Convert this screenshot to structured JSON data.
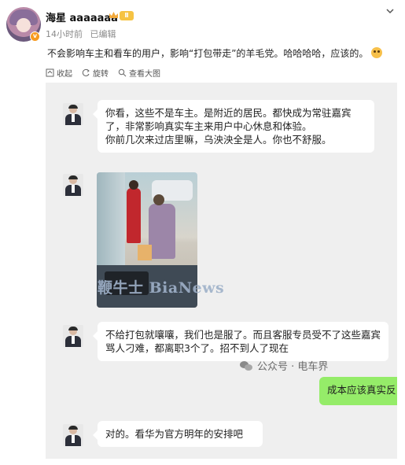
{
  "post": {
    "username": "海星 aaaaaaa",
    "level_badge": "Ⅱ",
    "verified_mark": "v",
    "time": "14小时前",
    "edited": "已编辑",
    "text": "不会影响车主和看车的用户，影响“打包带走”的羊毛党。哈哈哈哈，应该的。",
    "emoji_icon": "laughing-emoji-icon"
  },
  "actions": {
    "collapse": "收起",
    "rotate": "旋转",
    "view_large": "查看大图"
  },
  "chat": {
    "message1": "你看，这些不是车主。是附近的居民。都快成为常驻嘉宾了，非常影响真实车主来用户中心休息和体验。\n你前几次来过店里嘛，乌泱泱全是人。你也不舒服。",
    "message3": "不给打包就嚷嚷，我们也是服了。而且客服专员受不了这些嘉宾骂人刁难，都离职3个了。招不到人了现在",
    "reply": "成本应该真实反",
    "message4": "对的。看华为官方明年的安排吧"
  },
  "watermarks": {
    "bianews": "鞭牛士 BiaNews",
    "wechat": "公众号 · 电车界"
  },
  "colors": {
    "bubble_green": "#95ec69",
    "chat_bg": "#efefef",
    "vip_orange": "#f79a1f"
  }
}
